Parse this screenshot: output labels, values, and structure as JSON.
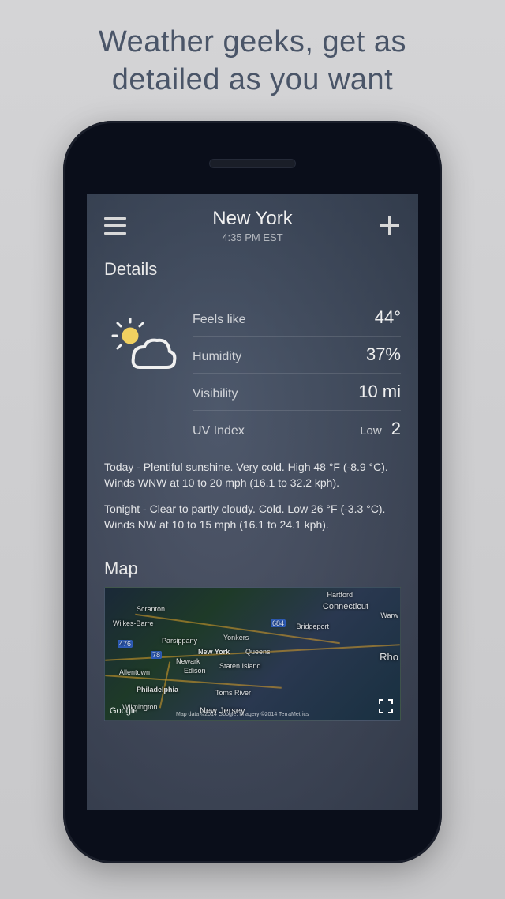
{
  "promo": {
    "line1": "Weather geeks, get as",
    "line2": "detailed as you want"
  },
  "header": {
    "location": "New York",
    "time": "4:35 PM EST"
  },
  "details": {
    "title": "Details",
    "rows": [
      {
        "label": "Feels like",
        "value": "44°"
      },
      {
        "label": "Humidity",
        "value": "37%"
      },
      {
        "label": "Visibility",
        "value": "10 mi"
      },
      {
        "label": "UV Index",
        "level": "Low",
        "value": "2"
      }
    ]
  },
  "forecast": {
    "today": "Today - Plentiful sunshine. Very cold. High 48 °F (-8.9 °C). Winds WNW at 10 to 20 mph (16.1 to 32.2 kph).",
    "tonight": "Tonight - Clear to partly cloudy. Cold. Low 26 °F (-3.3 °C). Winds NW at 10 to 15 mph (16.1 to 24.1 kph)."
  },
  "map": {
    "title": "Map",
    "provider": "Google",
    "attribution": "Map data ©2014 Google. Imagery ©2014 TerraMetrics",
    "places": [
      "Hartford",
      "Connecticut",
      "Scranton",
      "Wilkes-Barre",
      "Parsippany",
      "Yonkers",
      "Bridgeport",
      "New York",
      "Queens",
      "Newark",
      "Edison",
      "Staten Island",
      "Allentown",
      "Philadelphia",
      "Toms River",
      "Wilmington",
      "New Jersey",
      "Rho",
      "Warw",
      "684",
      "476",
      "78"
    ]
  }
}
